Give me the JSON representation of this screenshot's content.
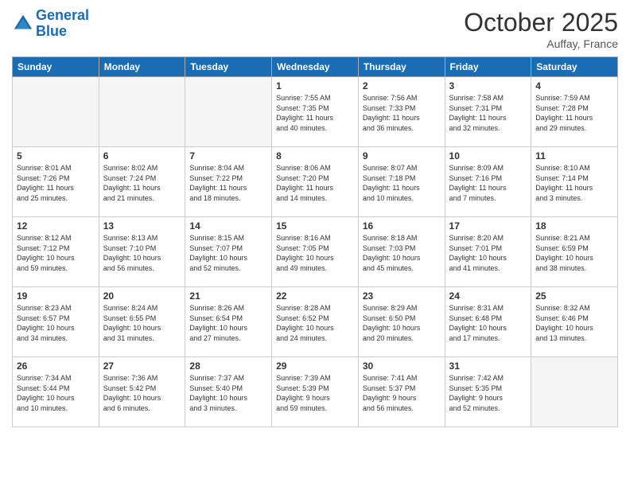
{
  "header": {
    "logo_line1": "General",
    "logo_line2": "Blue",
    "month_title": "October 2025",
    "location": "Auffay, France"
  },
  "weekdays": [
    "Sunday",
    "Monday",
    "Tuesday",
    "Wednesday",
    "Thursday",
    "Friday",
    "Saturday"
  ],
  "weeks": [
    [
      {
        "day": "",
        "info": ""
      },
      {
        "day": "",
        "info": ""
      },
      {
        "day": "",
        "info": ""
      },
      {
        "day": "1",
        "info": "Sunrise: 7:55 AM\nSunset: 7:35 PM\nDaylight: 11 hours\nand 40 minutes."
      },
      {
        "day": "2",
        "info": "Sunrise: 7:56 AM\nSunset: 7:33 PM\nDaylight: 11 hours\nand 36 minutes."
      },
      {
        "day": "3",
        "info": "Sunrise: 7:58 AM\nSunset: 7:31 PM\nDaylight: 11 hours\nand 32 minutes."
      },
      {
        "day": "4",
        "info": "Sunrise: 7:59 AM\nSunset: 7:28 PM\nDaylight: 11 hours\nand 29 minutes."
      }
    ],
    [
      {
        "day": "5",
        "info": "Sunrise: 8:01 AM\nSunset: 7:26 PM\nDaylight: 11 hours\nand 25 minutes."
      },
      {
        "day": "6",
        "info": "Sunrise: 8:02 AM\nSunset: 7:24 PM\nDaylight: 11 hours\nand 21 minutes."
      },
      {
        "day": "7",
        "info": "Sunrise: 8:04 AM\nSunset: 7:22 PM\nDaylight: 11 hours\nand 18 minutes."
      },
      {
        "day": "8",
        "info": "Sunrise: 8:06 AM\nSunset: 7:20 PM\nDaylight: 11 hours\nand 14 minutes."
      },
      {
        "day": "9",
        "info": "Sunrise: 8:07 AM\nSunset: 7:18 PM\nDaylight: 11 hours\nand 10 minutes."
      },
      {
        "day": "10",
        "info": "Sunrise: 8:09 AM\nSunset: 7:16 PM\nDaylight: 11 hours\nand 7 minutes."
      },
      {
        "day": "11",
        "info": "Sunrise: 8:10 AM\nSunset: 7:14 PM\nDaylight: 11 hours\nand 3 minutes."
      }
    ],
    [
      {
        "day": "12",
        "info": "Sunrise: 8:12 AM\nSunset: 7:12 PM\nDaylight: 10 hours\nand 59 minutes."
      },
      {
        "day": "13",
        "info": "Sunrise: 8:13 AM\nSunset: 7:10 PM\nDaylight: 10 hours\nand 56 minutes."
      },
      {
        "day": "14",
        "info": "Sunrise: 8:15 AM\nSunset: 7:07 PM\nDaylight: 10 hours\nand 52 minutes."
      },
      {
        "day": "15",
        "info": "Sunrise: 8:16 AM\nSunset: 7:05 PM\nDaylight: 10 hours\nand 49 minutes."
      },
      {
        "day": "16",
        "info": "Sunrise: 8:18 AM\nSunset: 7:03 PM\nDaylight: 10 hours\nand 45 minutes."
      },
      {
        "day": "17",
        "info": "Sunrise: 8:20 AM\nSunset: 7:01 PM\nDaylight: 10 hours\nand 41 minutes."
      },
      {
        "day": "18",
        "info": "Sunrise: 8:21 AM\nSunset: 6:59 PM\nDaylight: 10 hours\nand 38 minutes."
      }
    ],
    [
      {
        "day": "19",
        "info": "Sunrise: 8:23 AM\nSunset: 6:57 PM\nDaylight: 10 hours\nand 34 minutes."
      },
      {
        "day": "20",
        "info": "Sunrise: 8:24 AM\nSunset: 6:55 PM\nDaylight: 10 hours\nand 31 minutes."
      },
      {
        "day": "21",
        "info": "Sunrise: 8:26 AM\nSunset: 6:54 PM\nDaylight: 10 hours\nand 27 minutes."
      },
      {
        "day": "22",
        "info": "Sunrise: 8:28 AM\nSunset: 6:52 PM\nDaylight: 10 hours\nand 24 minutes."
      },
      {
        "day": "23",
        "info": "Sunrise: 8:29 AM\nSunset: 6:50 PM\nDaylight: 10 hours\nand 20 minutes."
      },
      {
        "day": "24",
        "info": "Sunrise: 8:31 AM\nSunset: 6:48 PM\nDaylight: 10 hours\nand 17 minutes."
      },
      {
        "day": "25",
        "info": "Sunrise: 8:32 AM\nSunset: 6:46 PM\nDaylight: 10 hours\nand 13 minutes."
      }
    ],
    [
      {
        "day": "26",
        "info": "Sunrise: 7:34 AM\nSunset: 5:44 PM\nDaylight: 10 hours\nand 10 minutes."
      },
      {
        "day": "27",
        "info": "Sunrise: 7:36 AM\nSunset: 5:42 PM\nDaylight: 10 hours\nand 6 minutes."
      },
      {
        "day": "28",
        "info": "Sunrise: 7:37 AM\nSunset: 5:40 PM\nDaylight: 10 hours\nand 3 minutes."
      },
      {
        "day": "29",
        "info": "Sunrise: 7:39 AM\nSunset: 5:39 PM\nDaylight: 9 hours\nand 59 minutes."
      },
      {
        "day": "30",
        "info": "Sunrise: 7:41 AM\nSunset: 5:37 PM\nDaylight: 9 hours\nand 56 minutes."
      },
      {
        "day": "31",
        "info": "Sunrise: 7:42 AM\nSunset: 5:35 PM\nDaylight: 9 hours\nand 52 minutes."
      },
      {
        "day": "",
        "info": ""
      }
    ]
  ]
}
